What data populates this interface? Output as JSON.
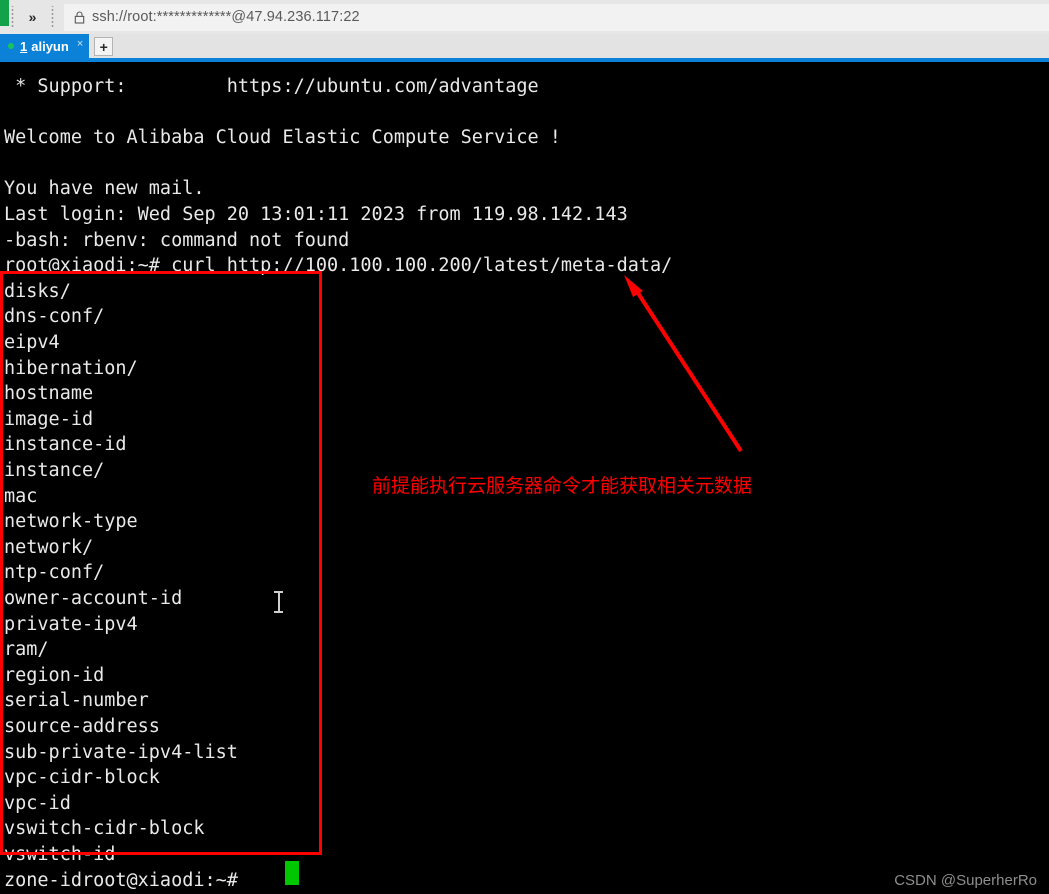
{
  "toolbar": {
    "chevron_label": "»",
    "address_value": "ssh://root:*************@47.94.236.117:22",
    "address_placeholder": "ssh://"
  },
  "tabs": {
    "items": [
      {
        "number": "1",
        "label": "aliyun",
        "close_label": "×"
      }
    ],
    "new_tab_label": "+"
  },
  "terminal": {
    "header_lines": [
      " * Support:         https://ubuntu.com/advantage",
      "",
      "Welcome to Alibaba Cloud Elastic Compute Service !",
      "",
      "You have new mail.",
      "Last login: Wed Sep 20 13:01:11 2023 from 119.98.142.143",
      "-bash: rbenv: command not found"
    ],
    "command_line": "root@xiaodi:~# curl http://100.100.100.200/latest/meta-data/",
    "metadata_entries": [
      "disks/",
      "dns-conf/",
      "eipv4",
      "hibernation/",
      "hostname",
      "image-id",
      "instance-id",
      "instance/",
      "mac",
      "network-type",
      "network/",
      "ntp-conf/",
      "owner-account-id",
      "private-ipv4",
      "ram/",
      "region-id",
      "serial-number",
      "source-address",
      "sub-private-ipv4-list",
      "vpc-cidr-block",
      "vpc-id",
      "vswitch-cidr-block",
      "vswitch-id"
    ],
    "final_line": "zone-idroot@xiaodi:~#"
  },
  "annotations": {
    "note_text": "前提能执行云服务器命令才能获取相关元数据",
    "highlight_color": "#ff0000",
    "arrow_color": "#ff0000"
  },
  "watermark": {
    "text": "CSDN @SuperherRo"
  },
  "colors": {
    "tab_active": "#0b82d8",
    "terminal_bg": "#000000",
    "terminal_fg": "#e9e9e9",
    "cursor": "#00c800",
    "status_dot": "#16c45a"
  }
}
